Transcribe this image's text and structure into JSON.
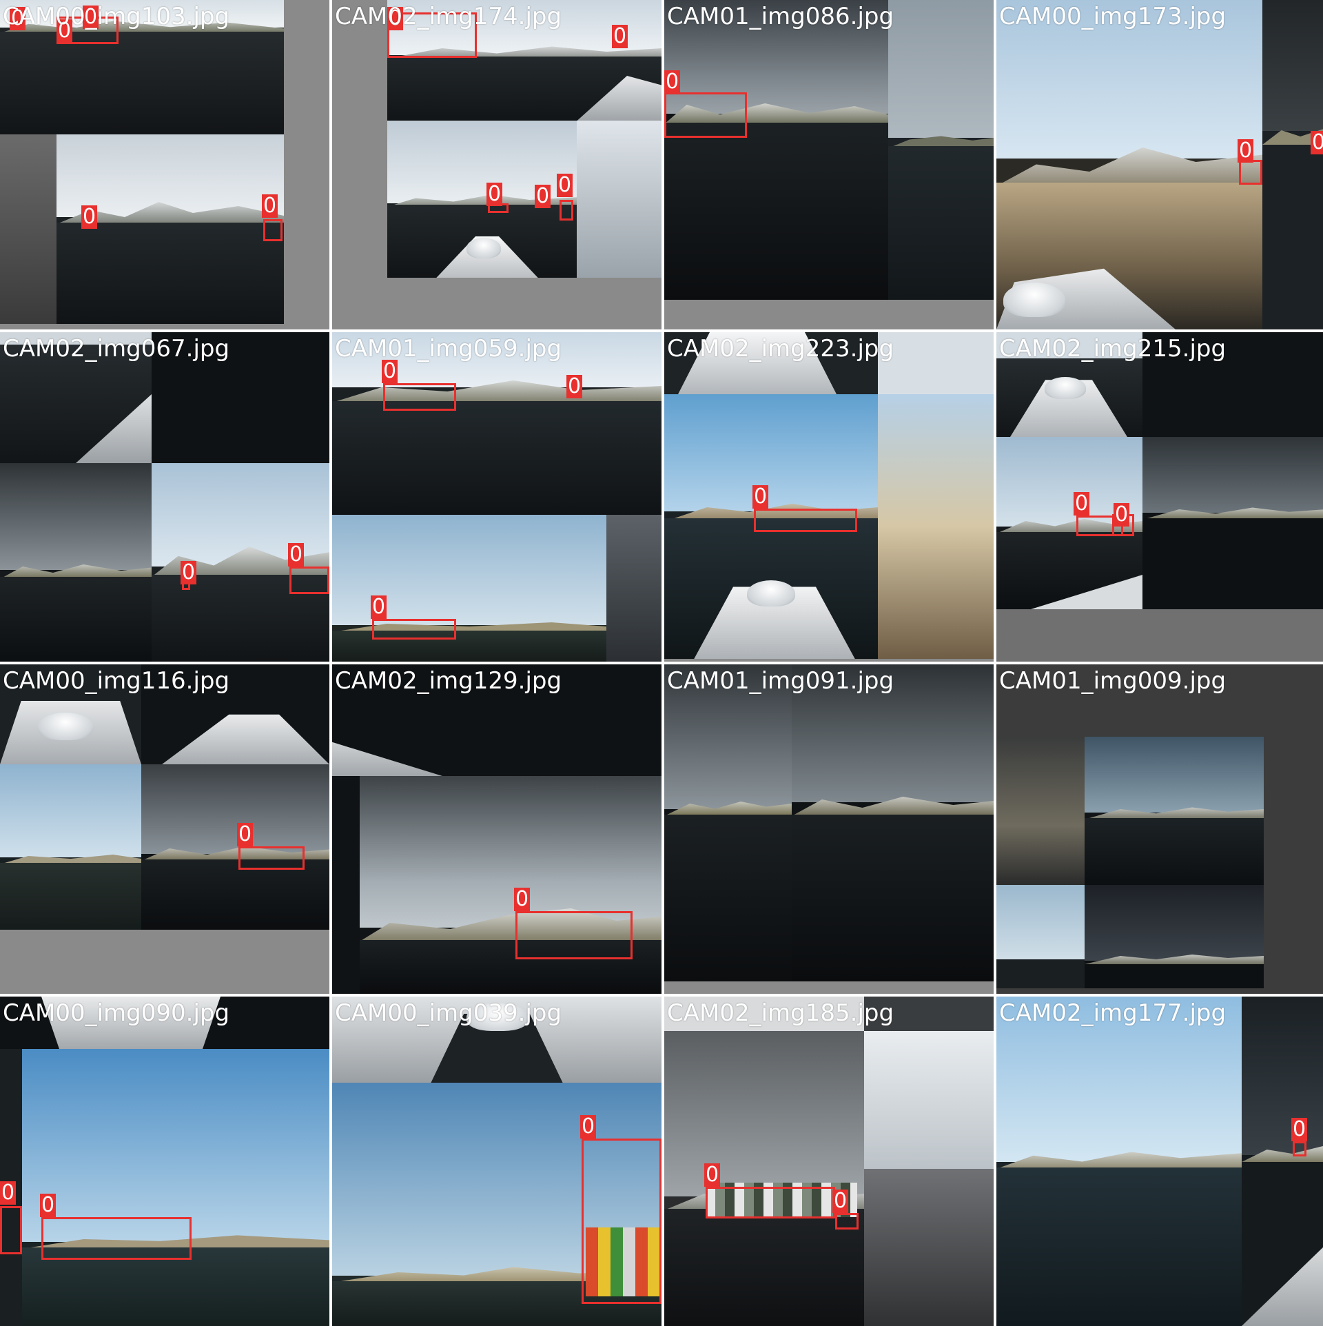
{
  "tiles": [
    {
      "name": "CAM00_img103.jpg"
    },
    {
      "name": "CAM02_img174.jpg"
    },
    {
      "name": "CAM01_img086.jpg"
    },
    {
      "name": "CAM00_img173.jpg"
    },
    {
      "name": "CAM02_img067.jpg"
    },
    {
      "name": "CAM01_img059.jpg"
    },
    {
      "name": "CAM02_img223.jpg"
    },
    {
      "name": "CAM02_img215.jpg"
    },
    {
      "name": "CAM00_img116.jpg"
    },
    {
      "name": "CAM02_img129.jpg"
    },
    {
      "name": "CAM01_img091.jpg"
    },
    {
      "name": "CAM01_img009.jpg"
    },
    {
      "name": "CAM00_img090.jpg"
    },
    {
      "name": "CAM00_img039.jpg"
    },
    {
      "name": "CAM02_img185.jpg"
    },
    {
      "name": "CAM02_img177.jpg"
    }
  ],
  "class_label": "0",
  "colors": {
    "box": "#e8302e",
    "pad": "#8a8a8a",
    "text": "#ffffff"
  }
}
